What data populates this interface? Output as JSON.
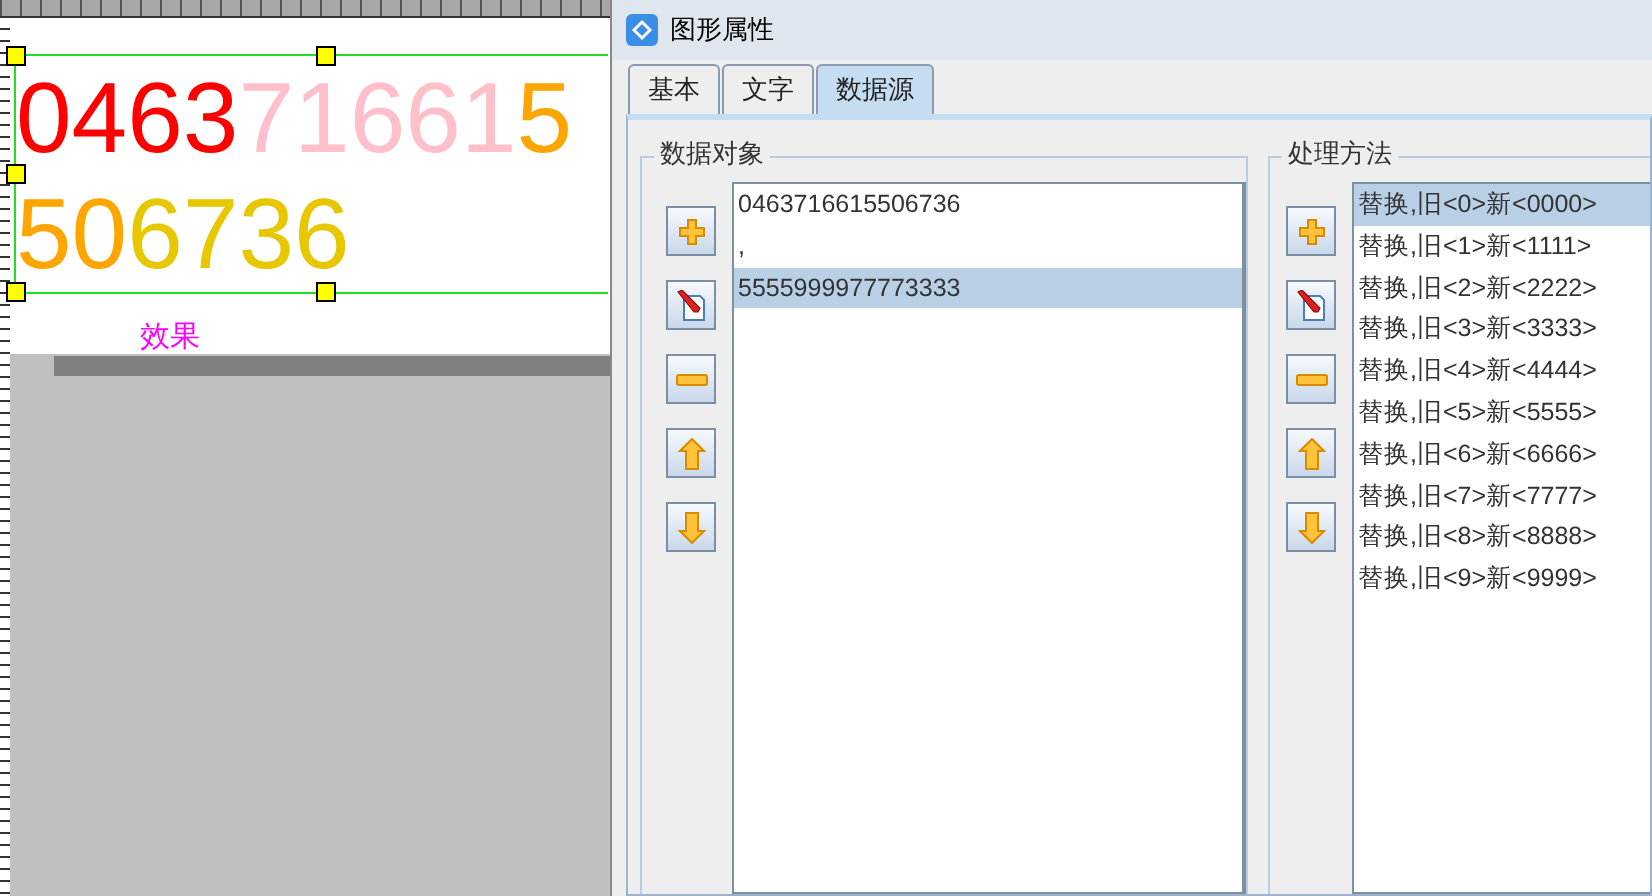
{
  "canvas": {
    "barcode_lines": [
      [
        {
          "text": "0463",
          "color": "#ff0000"
        },
        {
          "text": "71661",
          "color": "#ffc0cb"
        },
        {
          "text": "5",
          "color": "#ffa500"
        }
      ],
      [
        {
          "text": "50",
          "color": "#ffa500"
        },
        {
          "text": "6736",
          "color": "#e6c700"
        }
      ]
    ],
    "caption": "效果"
  },
  "window": {
    "title": "图形属性"
  },
  "tabs": [
    {
      "label": "基本",
      "selected": false
    },
    {
      "label": "文字",
      "selected": false
    },
    {
      "label": "数据源",
      "selected": true
    }
  ],
  "data_objects": {
    "title": "数据对象",
    "items": [
      {
        "text": "0463716615506736",
        "selected": false
      },
      {
        "text": ",",
        "selected": false
      },
      {
        "text": "5555999977773333",
        "selected": true
      }
    ]
  },
  "methods": {
    "title": "处理方法",
    "items": [
      {
        "text": "替换,旧<0>新<0000>",
        "selected": true
      },
      {
        "text": "替换,旧<1>新<1111>",
        "selected": false
      },
      {
        "text": "替换,旧<2>新<2222>",
        "selected": false
      },
      {
        "text": "替换,旧<3>新<3333>",
        "selected": false
      },
      {
        "text": "替换,旧<4>新<4444>",
        "selected": false
      },
      {
        "text": "替换,旧<5>新<5555>",
        "selected": false
      },
      {
        "text": "替换,旧<6>新<6666>",
        "selected": false
      },
      {
        "text": "替换,旧<7>新<7777>",
        "selected": false
      },
      {
        "text": "替换,旧<8>新<8888>",
        "selected": false
      },
      {
        "text": "替换,旧<9>新<9999>",
        "selected": false
      }
    ]
  }
}
